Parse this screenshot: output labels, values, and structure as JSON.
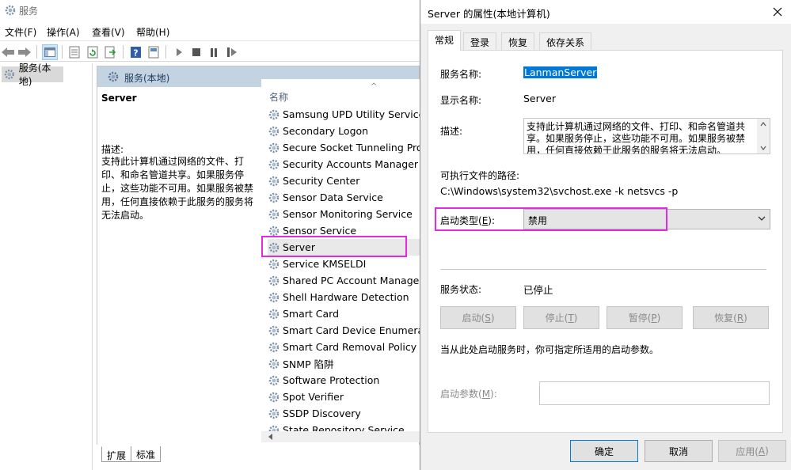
{
  "main_window": {
    "title": "服务",
    "menu": [
      "文件(F)",
      "操作(A)",
      "查看(V)",
      "帮助(H)"
    ],
    "tree_node": "服务(本地)",
    "panel_title": "服务(本地)",
    "selected_service_name": "Server",
    "description_label": "描述:",
    "description_text": "支持此计算机通过网络的文件、打印、和命名管道共享。如果服务停止，这些功能不可用。如果服务被禁用，任何直接依赖于此服务的服务将无法启动。",
    "list_header": "名称",
    "services": [
      "Samsung UPD Utility Service",
      "Secondary Logon",
      "Secure Socket Tunneling Proto",
      "Security Accounts Manager",
      "Security Center",
      "Sensor Data Service",
      "Sensor Monitoring Service",
      "Sensor Service",
      "Server",
      "Service KMSELDI",
      "Shared PC Account Manager",
      "Shell Hardware Detection",
      "Smart Card",
      "Smart Card Device Enumeratio",
      "Smart Card Removal Policy",
      "SNMP 陷阱",
      "Software Protection",
      "Spot Verifier",
      "SSDP Discovery",
      "State Repository Service"
    ],
    "selected_index": 8,
    "bottom_tabs": [
      "扩展",
      "标准"
    ]
  },
  "dialog": {
    "title": "Server 的属性(本地计算机)",
    "tabs": [
      "常规",
      "登录",
      "恢复",
      "依存关系"
    ],
    "active_tab": 0,
    "service_name_label": "服务名称:",
    "service_name": "LanmanServer",
    "display_name_label": "显示名称:",
    "display_name": "Server",
    "desc_label": "描述:",
    "desc_text": "支持此计算机通过网络的文件、打印、和命名管道共享。如果服务停止，这些功能不可用。如果服务被禁用，任何直接依赖于此服务的服务将无法启动。",
    "path_label": "可执行文件的路径:",
    "path": "C:\\Windows\\system32\\svchost.exe -k netsvcs -p",
    "startup_type_label": "启动类型(",
    "startup_type_key": "E",
    "startup_type_label_end": "):",
    "startup_type_value": "禁用",
    "status_label": "服务状态:",
    "status_value": "已停止",
    "service_buttons": [
      {
        "text": "启动(",
        "key": "S",
        "end": ")"
      },
      {
        "text": "停止(",
        "key": "T",
        "end": ")"
      },
      {
        "text": "暂停(",
        "key": "P",
        "end": ")"
      },
      {
        "text": "恢复(",
        "key": "R",
        "end": ")"
      }
    ],
    "hint": "当从此处启动服务时，你可指定所适用的启动参数。",
    "params_label": "启动参数(",
    "params_key": "M",
    "params_label_end": "):",
    "params_value": "",
    "footer_buttons": {
      "ok": "确定",
      "cancel": "取消",
      "apply_text": "应用(",
      "apply_key": "A",
      "apply_end": ")"
    }
  },
  "colors": {
    "highlight": "#e22be0",
    "selection": "#0078d7",
    "panel_header": "#c4d3e1"
  }
}
